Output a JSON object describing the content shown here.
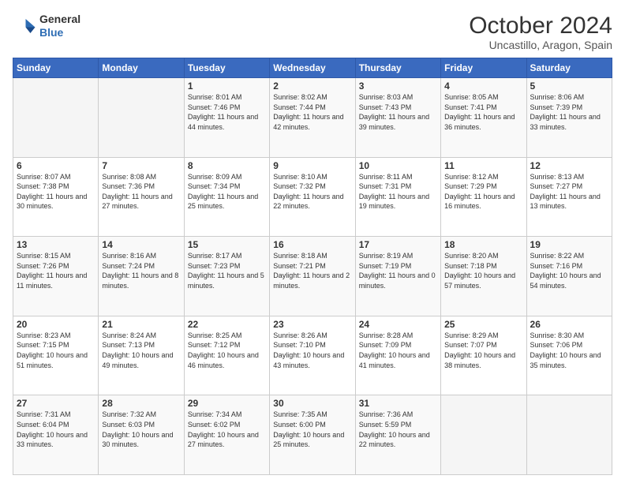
{
  "header": {
    "logo": {
      "line1": "General",
      "line2": "Blue"
    },
    "title": "October 2024",
    "subtitle": "Uncastillo, Aragon, Spain"
  },
  "weekdays": [
    "Sunday",
    "Monday",
    "Tuesday",
    "Wednesday",
    "Thursday",
    "Friday",
    "Saturday"
  ],
  "weeks": [
    [
      {
        "day": "",
        "info": ""
      },
      {
        "day": "",
        "info": ""
      },
      {
        "day": "1",
        "info": "Sunrise: 8:01 AM\nSunset: 7:46 PM\nDaylight: 11 hours and 44 minutes."
      },
      {
        "day": "2",
        "info": "Sunrise: 8:02 AM\nSunset: 7:44 PM\nDaylight: 11 hours and 42 minutes."
      },
      {
        "day": "3",
        "info": "Sunrise: 8:03 AM\nSunset: 7:43 PM\nDaylight: 11 hours and 39 minutes."
      },
      {
        "day": "4",
        "info": "Sunrise: 8:05 AM\nSunset: 7:41 PM\nDaylight: 11 hours and 36 minutes."
      },
      {
        "day": "5",
        "info": "Sunrise: 8:06 AM\nSunset: 7:39 PM\nDaylight: 11 hours and 33 minutes."
      }
    ],
    [
      {
        "day": "6",
        "info": "Sunrise: 8:07 AM\nSunset: 7:38 PM\nDaylight: 11 hours and 30 minutes."
      },
      {
        "day": "7",
        "info": "Sunrise: 8:08 AM\nSunset: 7:36 PM\nDaylight: 11 hours and 27 minutes."
      },
      {
        "day": "8",
        "info": "Sunrise: 8:09 AM\nSunset: 7:34 PM\nDaylight: 11 hours and 25 minutes."
      },
      {
        "day": "9",
        "info": "Sunrise: 8:10 AM\nSunset: 7:32 PM\nDaylight: 11 hours and 22 minutes."
      },
      {
        "day": "10",
        "info": "Sunrise: 8:11 AM\nSunset: 7:31 PM\nDaylight: 11 hours and 19 minutes."
      },
      {
        "day": "11",
        "info": "Sunrise: 8:12 AM\nSunset: 7:29 PM\nDaylight: 11 hours and 16 minutes."
      },
      {
        "day": "12",
        "info": "Sunrise: 8:13 AM\nSunset: 7:27 PM\nDaylight: 11 hours and 13 minutes."
      }
    ],
    [
      {
        "day": "13",
        "info": "Sunrise: 8:15 AM\nSunset: 7:26 PM\nDaylight: 11 hours and 11 minutes."
      },
      {
        "day": "14",
        "info": "Sunrise: 8:16 AM\nSunset: 7:24 PM\nDaylight: 11 hours and 8 minutes."
      },
      {
        "day": "15",
        "info": "Sunrise: 8:17 AM\nSunset: 7:23 PM\nDaylight: 11 hours and 5 minutes."
      },
      {
        "day": "16",
        "info": "Sunrise: 8:18 AM\nSunset: 7:21 PM\nDaylight: 11 hours and 2 minutes."
      },
      {
        "day": "17",
        "info": "Sunrise: 8:19 AM\nSunset: 7:19 PM\nDaylight: 11 hours and 0 minutes."
      },
      {
        "day": "18",
        "info": "Sunrise: 8:20 AM\nSunset: 7:18 PM\nDaylight: 10 hours and 57 minutes."
      },
      {
        "day": "19",
        "info": "Sunrise: 8:22 AM\nSunset: 7:16 PM\nDaylight: 10 hours and 54 minutes."
      }
    ],
    [
      {
        "day": "20",
        "info": "Sunrise: 8:23 AM\nSunset: 7:15 PM\nDaylight: 10 hours and 51 minutes."
      },
      {
        "day": "21",
        "info": "Sunrise: 8:24 AM\nSunset: 7:13 PM\nDaylight: 10 hours and 49 minutes."
      },
      {
        "day": "22",
        "info": "Sunrise: 8:25 AM\nSunset: 7:12 PM\nDaylight: 10 hours and 46 minutes."
      },
      {
        "day": "23",
        "info": "Sunrise: 8:26 AM\nSunset: 7:10 PM\nDaylight: 10 hours and 43 minutes."
      },
      {
        "day": "24",
        "info": "Sunrise: 8:28 AM\nSunset: 7:09 PM\nDaylight: 10 hours and 41 minutes."
      },
      {
        "day": "25",
        "info": "Sunrise: 8:29 AM\nSunset: 7:07 PM\nDaylight: 10 hours and 38 minutes."
      },
      {
        "day": "26",
        "info": "Sunrise: 8:30 AM\nSunset: 7:06 PM\nDaylight: 10 hours and 35 minutes."
      }
    ],
    [
      {
        "day": "27",
        "info": "Sunrise: 7:31 AM\nSunset: 6:04 PM\nDaylight: 10 hours and 33 minutes."
      },
      {
        "day": "28",
        "info": "Sunrise: 7:32 AM\nSunset: 6:03 PM\nDaylight: 10 hours and 30 minutes."
      },
      {
        "day": "29",
        "info": "Sunrise: 7:34 AM\nSunset: 6:02 PM\nDaylight: 10 hours and 27 minutes."
      },
      {
        "day": "30",
        "info": "Sunrise: 7:35 AM\nSunset: 6:00 PM\nDaylight: 10 hours and 25 minutes."
      },
      {
        "day": "31",
        "info": "Sunrise: 7:36 AM\nSunset: 5:59 PM\nDaylight: 10 hours and 22 minutes."
      },
      {
        "day": "",
        "info": ""
      },
      {
        "day": "",
        "info": ""
      }
    ]
  ]
}
